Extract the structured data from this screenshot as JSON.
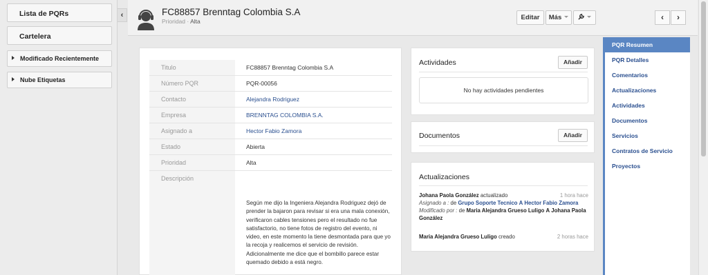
{
  "sidebar": {
    "items": [
      {
        "label": "Lista de PQRs"
      },
      {
        "label": "Cartelera"
      }
    ],
    "sections": [
      {
        "label": "Modificado Recientemente"
      },
      {
        "label": "Nube Etiquetas"
      }
    ]
  },
  "header": {
    "title": "FC88857 Brenntag Colombia S.A",
    "priority_label": "Prioridad",
    "priority_value": "Alta",
    "edit_label": "Editar",
    "more_label": "Más"
  },
  "details": {
    "rows": [
      {
        "label": "Titulo",
        "value": "FC88857 Brenntag Colombia S.A"
      },
      {
        "label": "Número PQR",
        "value": "PQR-00056"
      },
      {
        "label": "Contacto",
        "value": "Alejandra Rodriguez"
      },
      {
        "label": "Empresa",
        "value": "BRENNTAG COLOMBIA S.A."
      },
      {
        "label": "Asignado a",
        "value": "Hector Fabio Zamora"
      },
      {
        "label": "Estado",
        "value": "Abierta"
      },
      {
        "label": "Prioridad",
        "value": "Alta"
      }
    ],
    "description_label": "Descripción",
    "description": "Según me dijo la Ingeniera Alejandra Rodriguez dejó de prender la bajaron para revisar si era una mala conexión, verificaron cables tensiones pero el resultado no fue satisfactorio, no tiene fotos de registro del evento,  ni video, en este momento la tiene desmontada para que yo la recoja y realicemos el servicio de revisión. Adicionalmente me dice que el bombillo parece estar quemado debido a está negro."
  },
  "activities": {
    "title": "Actividades",
    "add_label": "Añadir",
    "empty_text": "No hay actividades pendientes"
  },
  "documents": {
    "title": "Documentos",
    "add_label": "Añadir"
  },
  "updates": {
    "title": "Actualizaciones",
    "entries": [
      {
        "user": "Johana Paola González",
        "action": "actualizado",
        "time": "1 hora hace",
        "assigned_label": "Asignado a",
        "assigned_from": "Grupo Soporte Tecnico",
        "assigned_sep": "A",
        "assigned_to": "Hector Fabio Zamora",
        "modified_label": "Modificado por",
        "modified_from": "Maria Alejandra Grueso Luligo",
        "modified_sep": "A",
        "modified_to": "Johana Paola González"
      },
      {
        "user": "Maria Alejandra Grueso Luligo",
        "action": "creado",
        "time": "2 horas hace"
      }
    ]
  },
  "right_nav": {
    "items": [
      {
        "label": "PQR Resumen"
      },
      {
        "label": "PQR Detalles"
      },
      {
        "label": "Comentarios"
      },
      {
        "label": "Actualizaciones"
      },
      {
        "label": "Actividades"
      },
      {
        "label": "Documentos"
      },
      {
        "label": "Servicios"
      },
      {
        "label": "Contratos de Servicio"
      },
      {
        "label": "Proyectos"
      }
    ]
  },
  "icons": {
    "avatar": "headset-user-icon",
    "tools": "wrench-icon",
    "prev": "chevron-left-icon",
    "next": "chevron-right-icon",
    "collapse": "chevron-left-icon"
  },
  "colors": {
    "accent": "#5a86c3",
    "link": "#2a4f8f"
  }
}
